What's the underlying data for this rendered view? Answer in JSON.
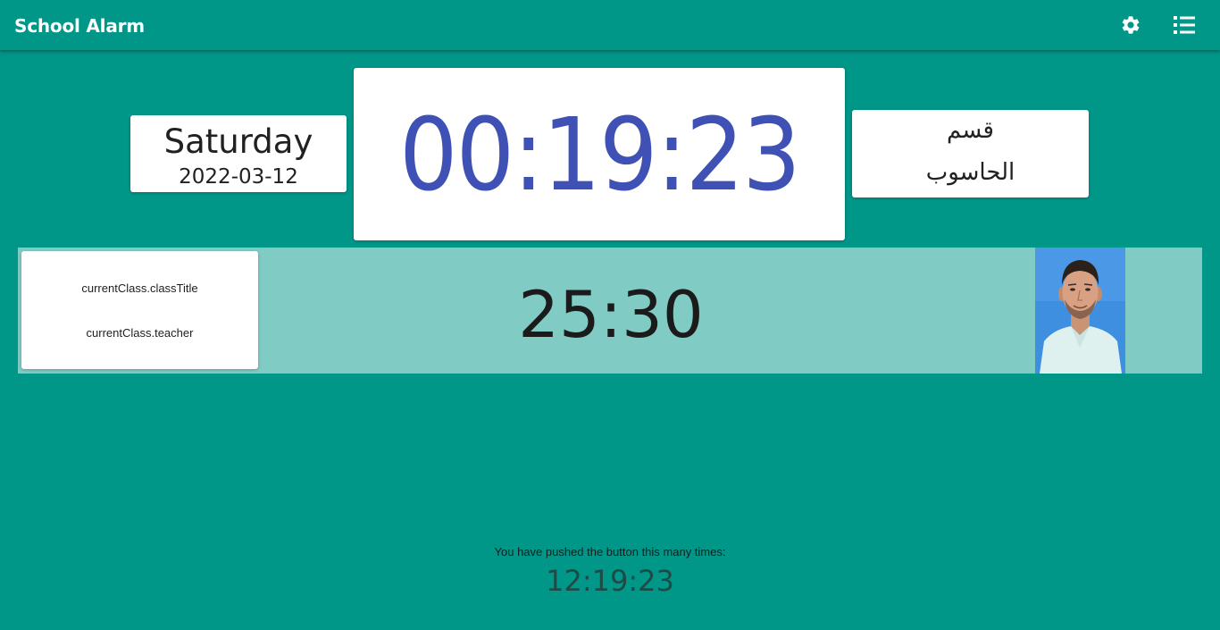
{
  "app_bar": {
    "title": "School Alarm",
    "actions": [
      {
        "icon": "gear-icon",
        "label": "Settings"
      },
      {
        "icon": "list-icon",
        "label": "Schedule list"
      }
    ]
  },
  "date_card": {
    "day_name": "Saturday",
    "date": "2022-03-12"
  },
  "clock": {
    "time": "00:19:23"
  },
  "department": {
    "line1": "قسم",
    "line2": "الحاسوب"
  },
  "current_class": {
    "title": "currentClass.classTitle",
    "teacher": "currentClass.teacher",
    "countdown": "25:30"
  },
  "counter": {
    "label": "You have pushed the button this many times:",
    "value": "12:19:23"
  },
  "colors": {
    "primary": "#009688",
    "band": "#80cbc4",
    "clock_text": "#3f51b5",
    "card": "#ffffff"
  }
}
